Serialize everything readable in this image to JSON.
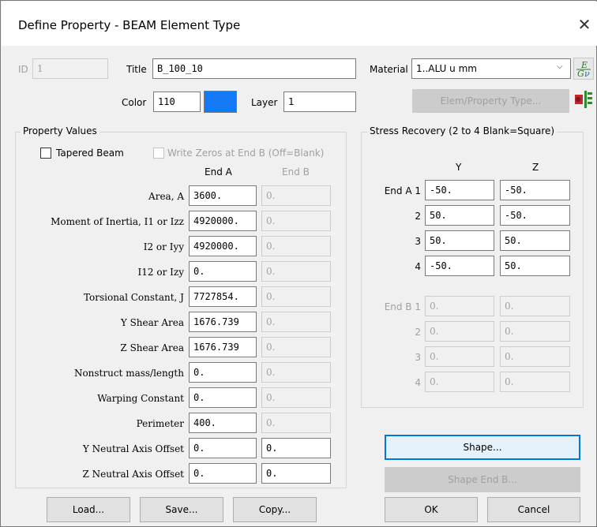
{
  "window": {
    "title": "Define Property - BEAM Element Type",
    "close_glyph": "✕"
  },
  "header": {
    "id_label": "ID",
    "id_value": "1",
    "title_label": "Title",
    "title_value": "B_100_10",
    "material_label": "Material",
    "material_value": "1..ALU u mm",
    "material_arrow": "⌵",
    "color_label": "Color",
    "color_value": "110",
    "color_swatch": "#1479f5",
    "layer_label": "Layer",
    "layer_value": "1",
    "elem_prop_button": "Elem/Property Type..."
  },
  "property_values": {
    "group_title": "Property Values",
    "tapered_label": "Tapered Beam",
    "write_zeros_label": "Write Zeros at End B (Off=Blank)",
    "col_end_a": "End A",
    "col_end_b": "End B",
    "rows": [
      {
        "label": "Area, A",
        "end_a": "3600.",
        "end_b": "0."
      },
      {
        "label": "Moment of Inertia, I1 or Izz",
        "end_a": "4920000.",
        "end_b": "0."
      },
      {
        "label": "I2 or Iyy",
        "end_a": "4920000.",
        "end_b": "0."
      },
      {
        "label": "I12 or Izy",
        "end_a": "0.",
        "end_b": "0."
      },
      {
        "label": "Torsional Constant, J",
        "end_a": "7727854.",
        "end_b": "0."
      },
      {
        "label": "Y Shear Area",
        "end_a": "1676.739",
        "end_b": "0."
      },
      {
        "label": "Z Shear Area",
        "end_a": "1676.739",
        "end_b": "0."
      },
      {
        "label": "Nonstruct mass/length",
        "end_a": "0.",
        "end_b": "0."
      },
      {
        "label": "Warping Constant",
        "end_a": "0.",
        "end_b": "0."
      },
      {
        "label": "Perimeter",
        "end_a": "400.",
        "end_b": "0."
      },
      {
        "label": "Y Neutral Axis Offset",
        "end_a": "0.",
        "end_b": "0."
      },
      {
        "label": "Z Neutral Axis Offset",
        "end_a": "0.",
        "end_b": "0."
      }
    ]
  },
  "stress_recovery": {
    "group_title": "Stress Recovery (2 to 4 Blank=Square)",
    "col_y": "Y",
    "col_z": "Z",
    "end_a_rows": [
      {
        "label": "End A 1",
        "y": "-50.",
        "z": "-50."
      },
      {
        "label": "2",
        "y": "50.",
        "z": "-50."
      },
      {
        "label": "3",
        "y": "50.",
        "z": "50."
      },
      {
        "label": "4",
        "y": "-50.",
        "z": "50."
      }
    ],
    "end_b_rows": [
      {
        "label": "End B 1",
        "y": "0.",
        "z": "0."
      },
      {
        "label": "2",
        "y": "0.",
        "z": "0."
      },
      {
        "label": "3",
        "y": "0.",
        "z": "0."
      },
      {
        "label": "4",
        "y": "0.",
        "z": "0."
      }
    ]
  },
  "buttons": {
    "shape": "Shape...",
    "shape_end_b": "Shape End B...",
    "load": "Load...",
    "save": "Save...",
    "copy": "Copy...",
    "ok": "OK",
    "cancel": "Cancel"
  }
}
